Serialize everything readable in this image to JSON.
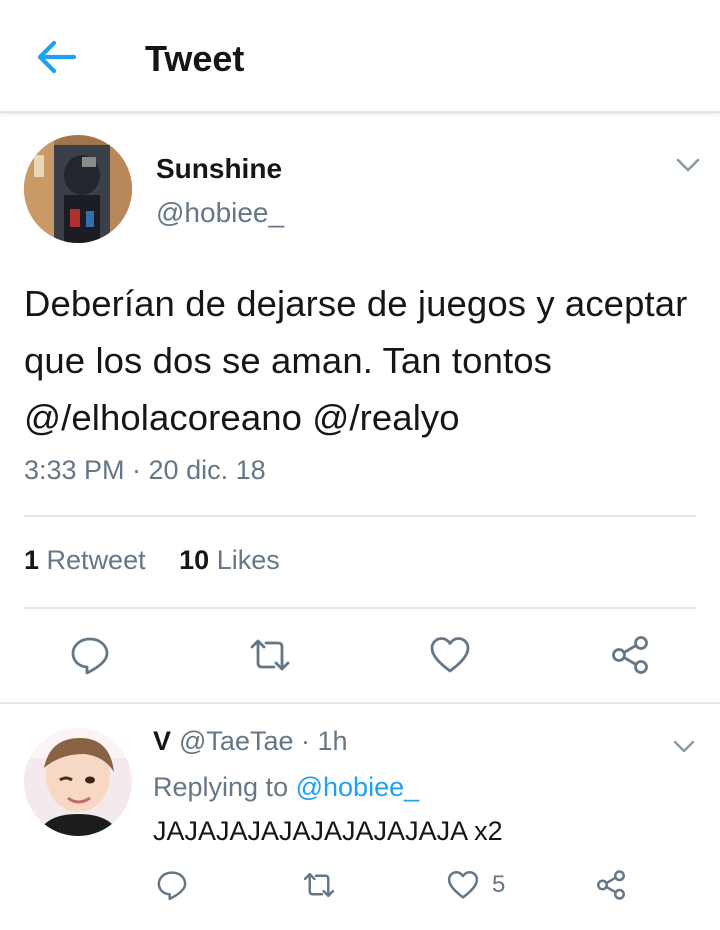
{
  "colors": {
    "accent": "#1da1f2",
    "text": "#14171a",
    "muted": "#657786",
    "divider": "#e1e8ed"
  },
  "header": {
    "title": "Tweet",
    "back_icon": "arrow-left-icon"
  },
  "tweet": {
    "display_name": "Sunshine",
    "handle": "@hobiee_",
    "text": "Deberían de dejarse de juegos y aceptar que los dos se aman. Tan tontos @/elholacoreano @/realyo",
    "timestamp": "3:33 PM · 20 dic. 18",
    "retweet_count": "1",
    "retweet_label": "Retweet",
    "like_count": "10",
    "like_label": "Likes",
    "actions": [
      "reply-icon",
      "retweet-icon",
      "heart-icon",
      "share-icon"
    ]
  },
  "reply": {
    "display_name": "V",
    "handle_time": "@TaeTae · 1h",
    "replying_prefix": "Replying to",
    "replying_to": "@hobiee_",
    "text": "JAJAJAJAJAJAJAJAJAJA x2",
    "like_count": "5",
    "actions": [
      "reply-icon",
      "retweet-icon",
      "heart-icon",
      "share-icon"
    ]
  }
}
